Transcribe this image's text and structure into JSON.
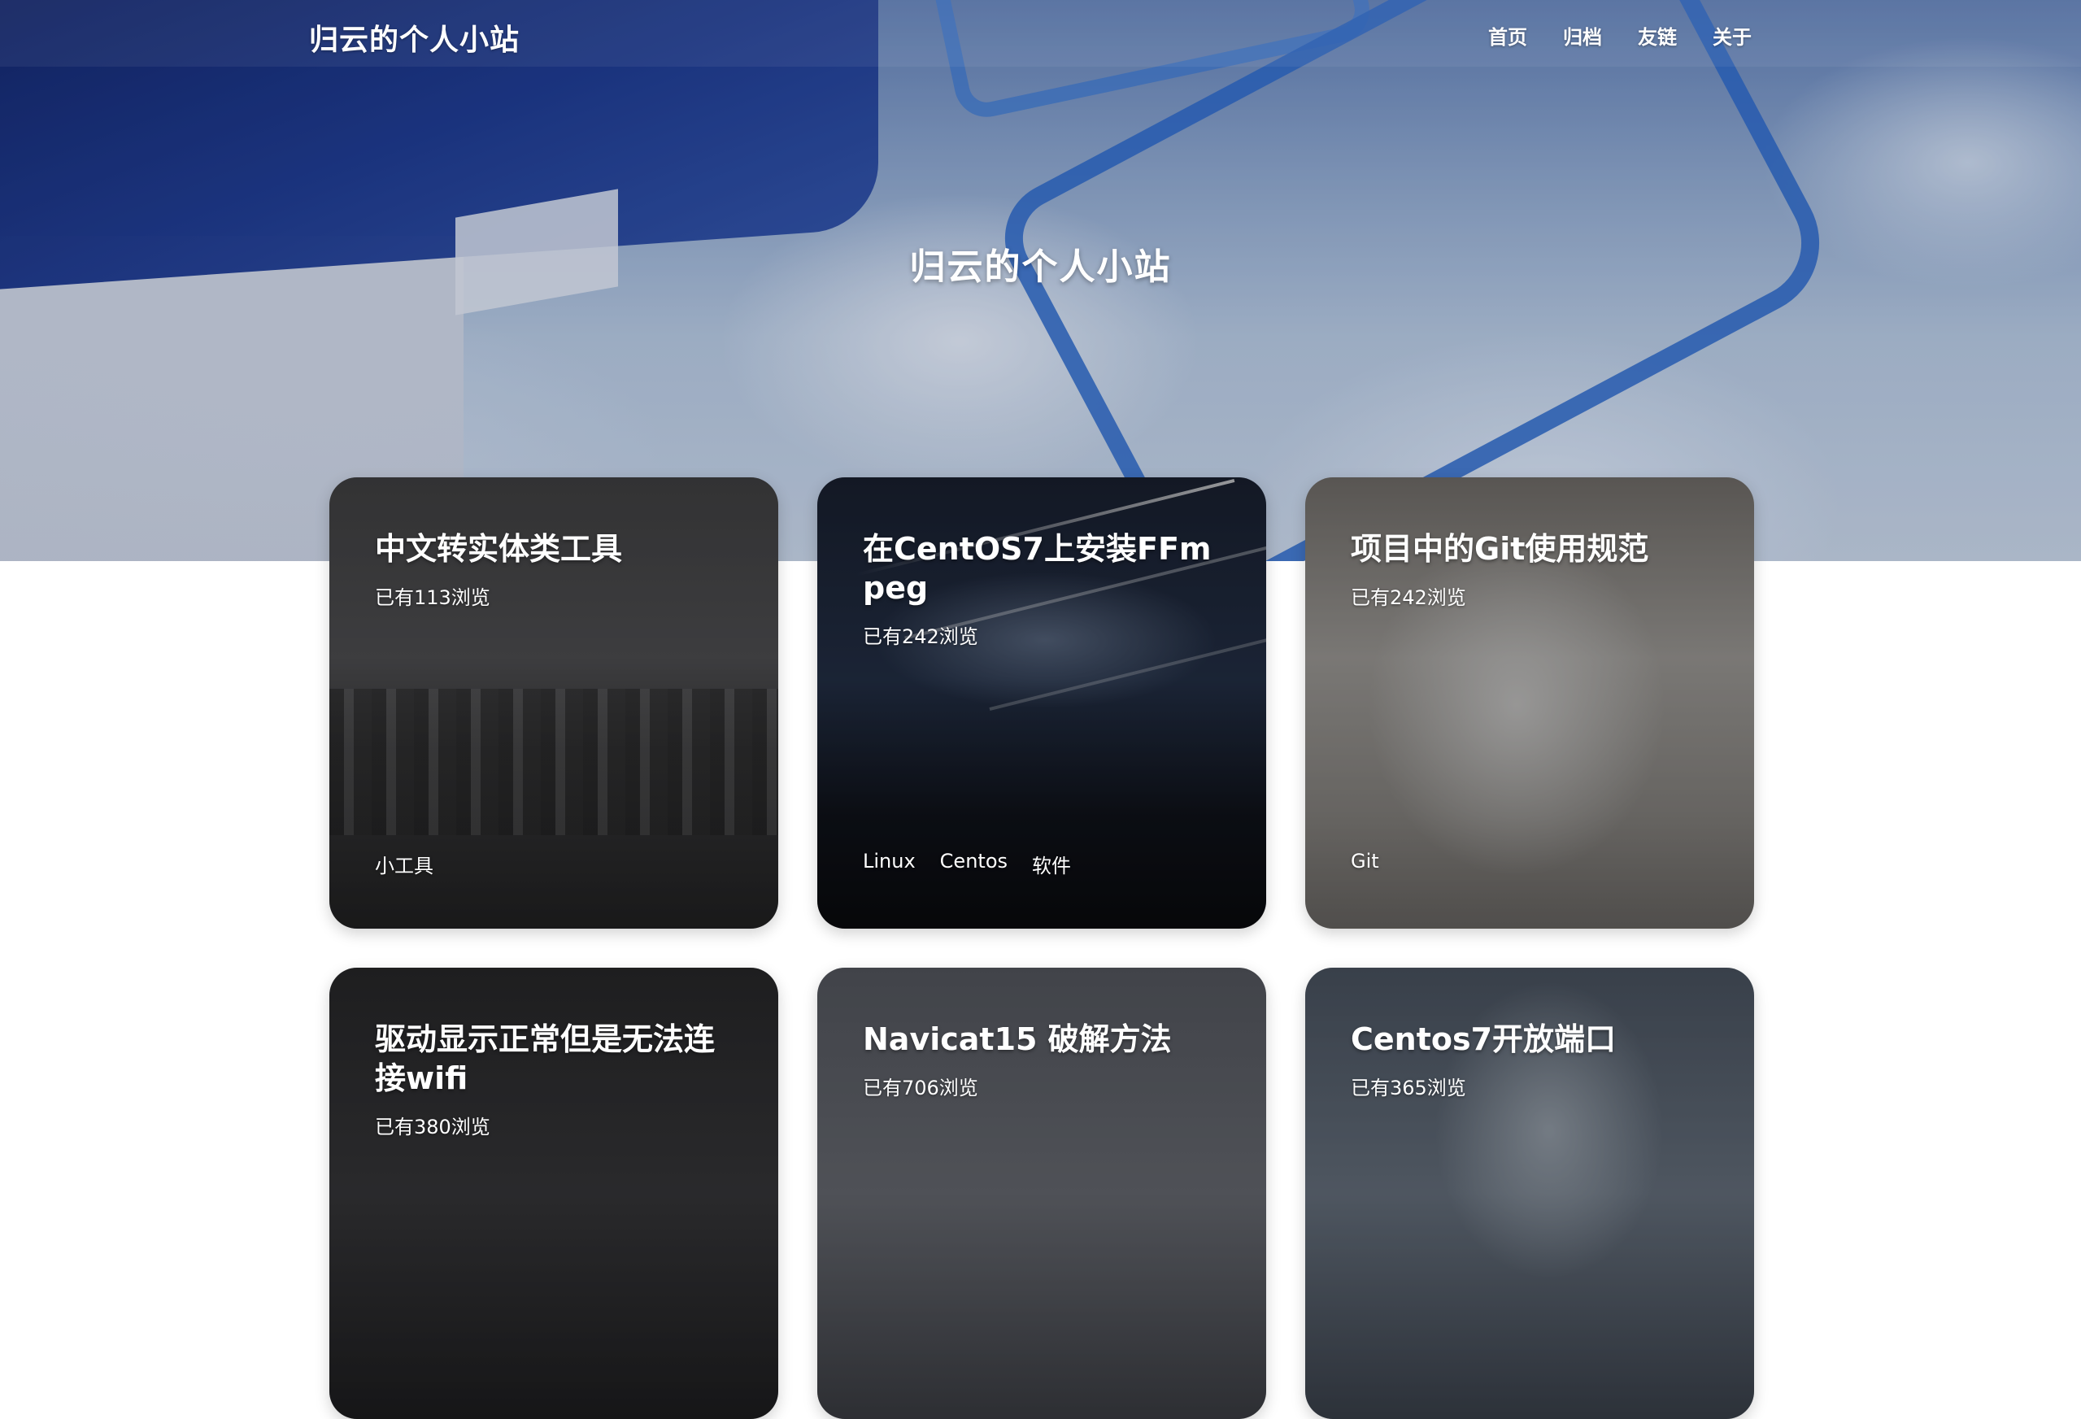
{
  "nav": {
    "brand": "归云的个人小站",
    "links": [
      "首页",
      "归档",
      "友链",
      "关于"
    ]
  },
  "hero": {
    "title": "归云的个人小站"
  },
  "posts": [
    {
      "title": "中文转实体类工具",
      "views": "已有113浏览",
      "tags": [
        "小工具"
      ]
    },
    {
      "title": "在CentOS7上安装FFmpeg",
      "views": "已有242浏览",
      "tags": [
        "Linux",
        "Centos",
        "软件"
      ]
    },
    {
      "title": "项目中的Git使用规范",
      "views": "已有242浏览",
      "tags": [
        "Git"
      ]
    },
    {
      "title": "驱动显示正常但是无法连接wifi",
      "views": "已有380浏览",
      "tags": []
    },
    {
      "title": "Navicat15 破解方法",
      "views": "已有706浏览",
      "tags": []
    },
    {
      "title": "Centos7开放端口",
      "views": "已有365浏览",
      "tags": []
    }
  ]
}
